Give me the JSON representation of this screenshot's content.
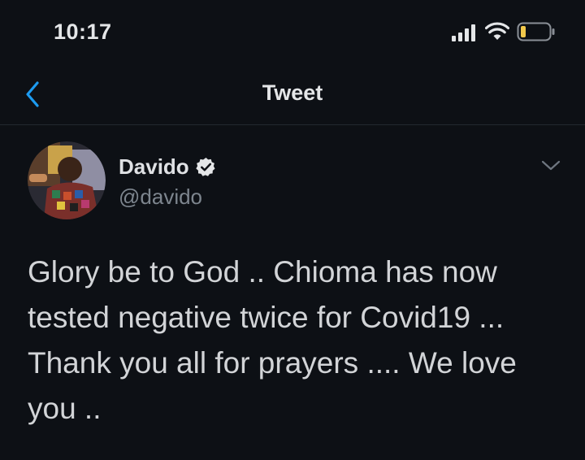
{
  "status_bar": {
    "time": "10:17",
    "icons": [
      "signal-icon",
      "wifi-icon",
      "battery-icon"
    ]
  },
  "nav": {
    "back_icon": "chevron-left-icon",
    "title": "Tweet"
  },
  "tweet": {
    "author_name": "Davido",
    "verified": true,
    "handle": "@davido",
    "more_icon": "chevron-down-icon",
    "text": "Glory be to God .. Chioma has now tested negative twice for Covid19 ... Thank you all for prayers .... We love you .."
  },
  "colors": {
    "background": "#0d1015",
    "accent": "#1d9bf0",
    "primary_text": "#dfe1e4",
    "secondary_text": "#7d858e",
    "battery_fill": "#f2c94c"
  }
}
